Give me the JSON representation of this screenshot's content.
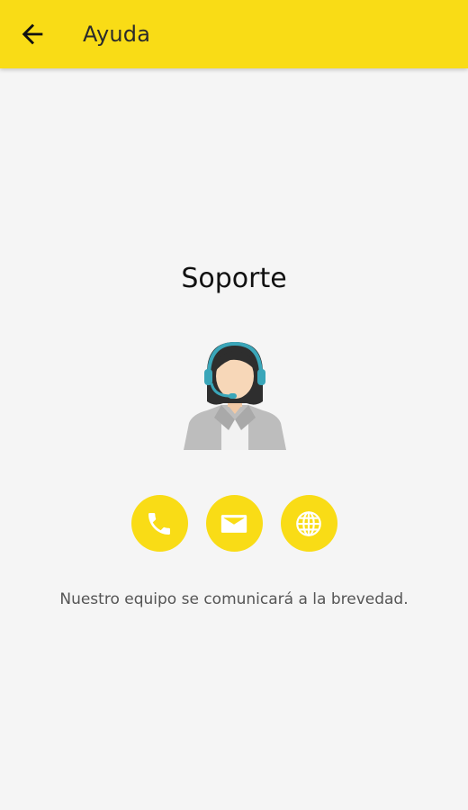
{
  "appbar": {
    "title": "Ayuda",
    "back_icon": "arrow-left-icon",
    "color": "#f9dc16"
  },
  "main": {
    "title": "Soporte",
    "avatar_icon": "support-agent-icon",
    "actions": [
      {
        "name": "call",
        "icon": "phone-icon"
      },
      {
        "name": "email",
        "icon": "mail-icon"
      },
      {
        "name": "web",
        "icon": "globe-icon"
      }
    ],
    "message": "Nuestro equipo se comunicará a la brevedad."
  }
}
